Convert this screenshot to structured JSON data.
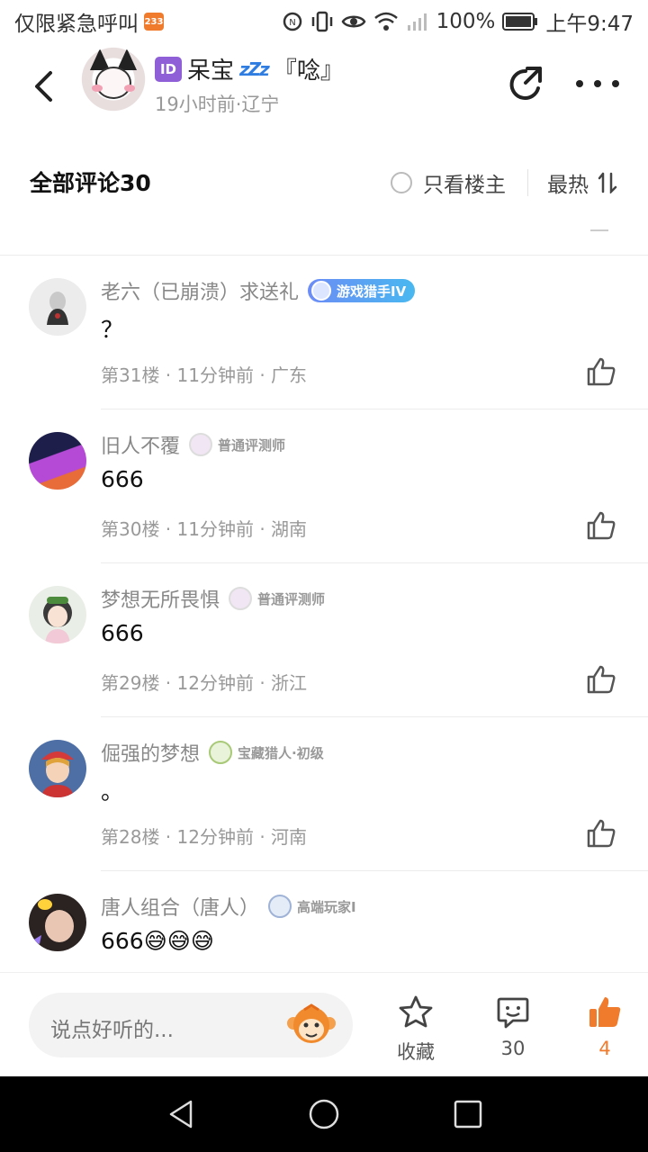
{
  "status_bar": {
    "carrier": "仅限紧急呼叫",
    "badge": "233",
    "battery": "100%",
    "time": "上午9:47"
  },
  "header": {
    "author_name": "呆宝",
    "id_badge": "ID",
    "zzz": "zZz",
    "author_suffix": "『唸』",
    "author_meta": "19小时前·辽宁"
  },
  "comments_header": {
    "title": "全部评论30",
    "only_op": "只看楼主",
    "sort": "最热"
  },
  "comments": [
    {
      "name": "老六（已崩溃）求送礼",
      "level": "游戏猎手IV",
      "text": "？",
      "meta": "第31楼 · 11分钟前 · 广东"
    },
    {
      "name": "旧人不覆",
      "level": "普通评测师",
      "text": "666",
      "meta": "第30楼 · 11分钟前 · 湖南"
    },
    {
      "name": "梦想无所畏惧",
      "level": "普通评测师",
      "text": "666",
      "meta": "第29楼 · 12分钟前 · 浙江"
    },
    {
      "name": "倔强的梦想",
      "level": "宝藏猎人·初级",
      "text": "。",
      "meta": "第28楼 · 12分钟前 · 河南"
    },
    {
      "name": "唐人组合（唐人）",
      "level": "高端玩家I",
      "text": "666😅😅😅",
      "meta": ""
    }
  ],
  "bottom_bar": {
    "placeholder": "说点好听的...",
    "collect_label": "收藏",
    "comment_count": "30",
    "like_count": "4"
  },
  "colors": {
    "accent": "#f07b2c",
    "id_badge": "#8e5fd6",
    "level_pill": "#5aa2f3"
  }
}
